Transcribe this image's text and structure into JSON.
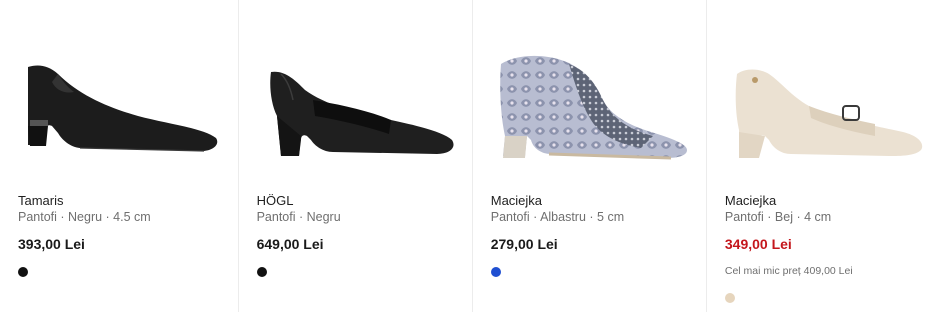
{
  "products": [
    {
      "brand": "Tamaris",
      "meta": "Pantofi · Negru · 4.5 cm",
      "price": "393,00 Lei",
      "note": "",
      "swatch": "#111111"
    },
    {
      "brand": "HÖGL",
      "meta": "Pantofi · Negru",
      "price": "649,00 Lei",
      "note": "",
      "swatch": "#111111"
    },
    {
      "brand": "Maciejka",
      "meta": "Pantofi · Albastru · 5 cm",
      "price": "279,00 Lei",
      "note": "",
      "swatch": "#1f4fd1"
    },
    {
      "brand": "Maciejka",
      "meta": "Pantofi · Bej · 4 cm",
      "price": "349,00 Lei",
      "note": "Cel mai mic preț 409,00 Lei",
      "swatch": "#e6d5bd"
    }
  ]
}
